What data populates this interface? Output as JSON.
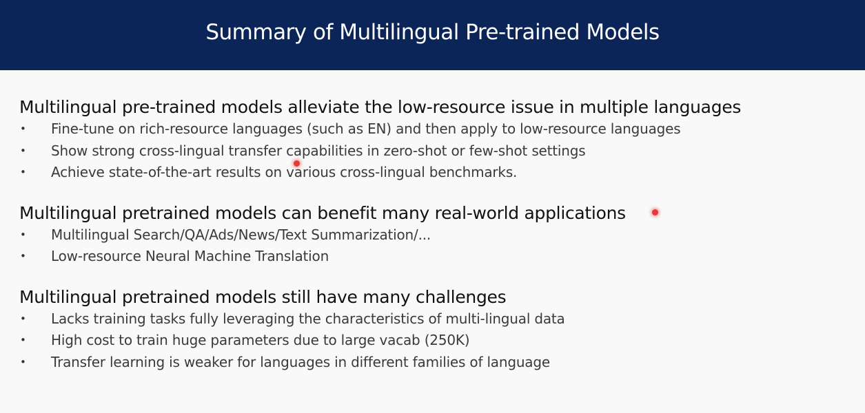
{
  "slide": {
    "title": "Summary of Multilingual Pre-trained Models"
  },
  "sections": [
    {
      "heading": "Multilingual pre-trained models alleviate the low-resource issue in multiple languages",
      "bullets": [
        "Fine-tune on rich-resource languages (such as EN) and then apply to low-resource languages",
        "Show strong cross-lingual transfer capabilities in zero-shot or few-shot settings",
        "Achieve state-of-the-art results on various cross-lingual benchmarks."
      ]
    },
    {
      "heading": "Multilingual pretrained models can benefit many real-world applications",
      "bullets": [
        "Multilingual Search/QA/Ads/News/Text Summarization/...",
        "Low-resource Neural Machine Translation"
      ]
    },
    {
      "heading": "Multilingual pretrained models still have many challenges",
      "bullets": [
        "Lacks training tasks fully leveraging the characteristics of multi-lingual data",
        "High cost to train huge parameters due to large vacab (250K)",
        "Transfer learning is weaker for languages in different families of language"
      ]
    }
  ],
  "bullet_symbol": "•",
  "colors": {
    "title_bar": "#0b2559",
    "title_text": "#ffffff",
    "pointer": "#e53935"
  }
}
